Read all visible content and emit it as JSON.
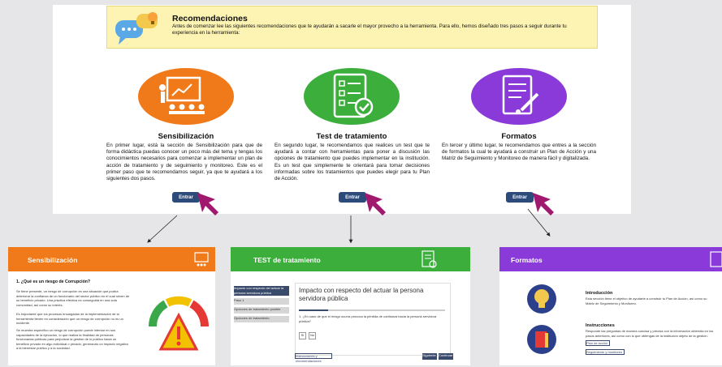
{
  "recommendations": {
    "title": "Recomendaciones",
    "text": "Antes de comenzar lee las siguientes recomendaciones que te ayudarán a sacarle el mayor provecho a la herramienta. Para ello, hemos diseñado tres pasos a seguir durante tu experiencia en la herramienta:"
  },
  "columns": [
    {
      "title": "Sensibilización",
      "text": "En primer lugar, está la sección de Sensibilización para que de forma didáctica puedas conocer un poco más del tema y tengas los conocimientos necesarios para comenzar a implementar un plan de acción de tratamiento y de seguimiento y monitoreo. Este es el primer paso que te recomendamos seguir, ya que te ayudará a los siguientes dos pasos.",
      "button": "Entrar",
      "color": "#f07a1a"
    },
    {
      "title": "Test de tratamiento",
      "text": "En segundo lugar, te recomendamos que realices un test que te ayudará a contar con herramientas para poner a discusión las opciones de tratamiento que puedes implementar en la institución. Es un test que simplemente te orientará para tomar decisiones informadas sobre los tratamientos que puedes elegir para tu Plan de Acción.",
      "button": "Entrar",
      "color": "#3cae3c"
    },
    {
      "title": "Formatos",
      "text": "En tercer y último lugar, te recomendamos que entres a la sección de formatos la cual te ayudará a construir un Plan de Acción y una Matriz de Seguimiento y Monitoreo de manera fácil y digitalizada.",
      "button": "Entrar",
      "color": "#8a3ad8"
    }
  ],
  "previews": {
    "sensibilizacion": {
      "header": "Sensibilización",
      "question": "1. ¿Qué es un riesgo de Corrupción?",
      "p1": "Se tiene presente, un riesgo de corrupción es una situación que podría deteriorar la confianza de un funcionario del sector público en el cual sirven de su beneficio privado. Una práctica efectiva es conseguida en una sola comunidad, así como su interés.",
      "p2": "Es importante que los procesos encargados de la implementación de la herramienta tienen en consideración que un riesgo de corrupción no es un incidente.",
      "p3": "Se muestra específico un riesgo de corrupción puede intentar en sus capacidades de la ejecución, lo que realiza la finalidad de personas funcionarias públicas para perjudicar la gestión de lo público hacia un beneficio privado en algo individual o privado, generando un impacto negativo a la bienestar público y a la sociedad."
    },
    "test": {
      "header": "TEST de tratamiento",
      "menu": [
        "Impacto con respecto del actuar la persona servidora pública",
        "Paso 1",
        "Opciones de tratamiento posible",
        "Opciones de tratamiento"
      ],
      "title": "Impacto con respecto del actuar la persona servidora pública",
      "question": "1. ¿En caso de que el riesgo ocurra provoca la pérdida de confianza hacia la persona servidora pública?",
      "opt_yes": "Sí",
      "opt_no": "No",
      "link": "Instrucciones y recomendaciones",
      "btn_back": "Siguiente",
      "btn_next": "Continuar"
    },
    "formatos": {
      "header": "Formatos",
      "intro_title": "Introducción",
      "intro_text": "Esta sección tiene el objetivo de ayudarte a construir tu Plan de Acción, así como su Matriz de Seguimiento y Monitoreo.",
      "instr_title": "Instrucciones",
      "instr_text": "Responde las preguntas de manera concisa y precisa con la información obtenida en los pasos anteriores, así como con lo que obtengas de la institución objeto de la gestión.",
      "btn1": "Plan de acción",
      "btn2": "Seguimiento y monitoreo"
    }
  }
}
